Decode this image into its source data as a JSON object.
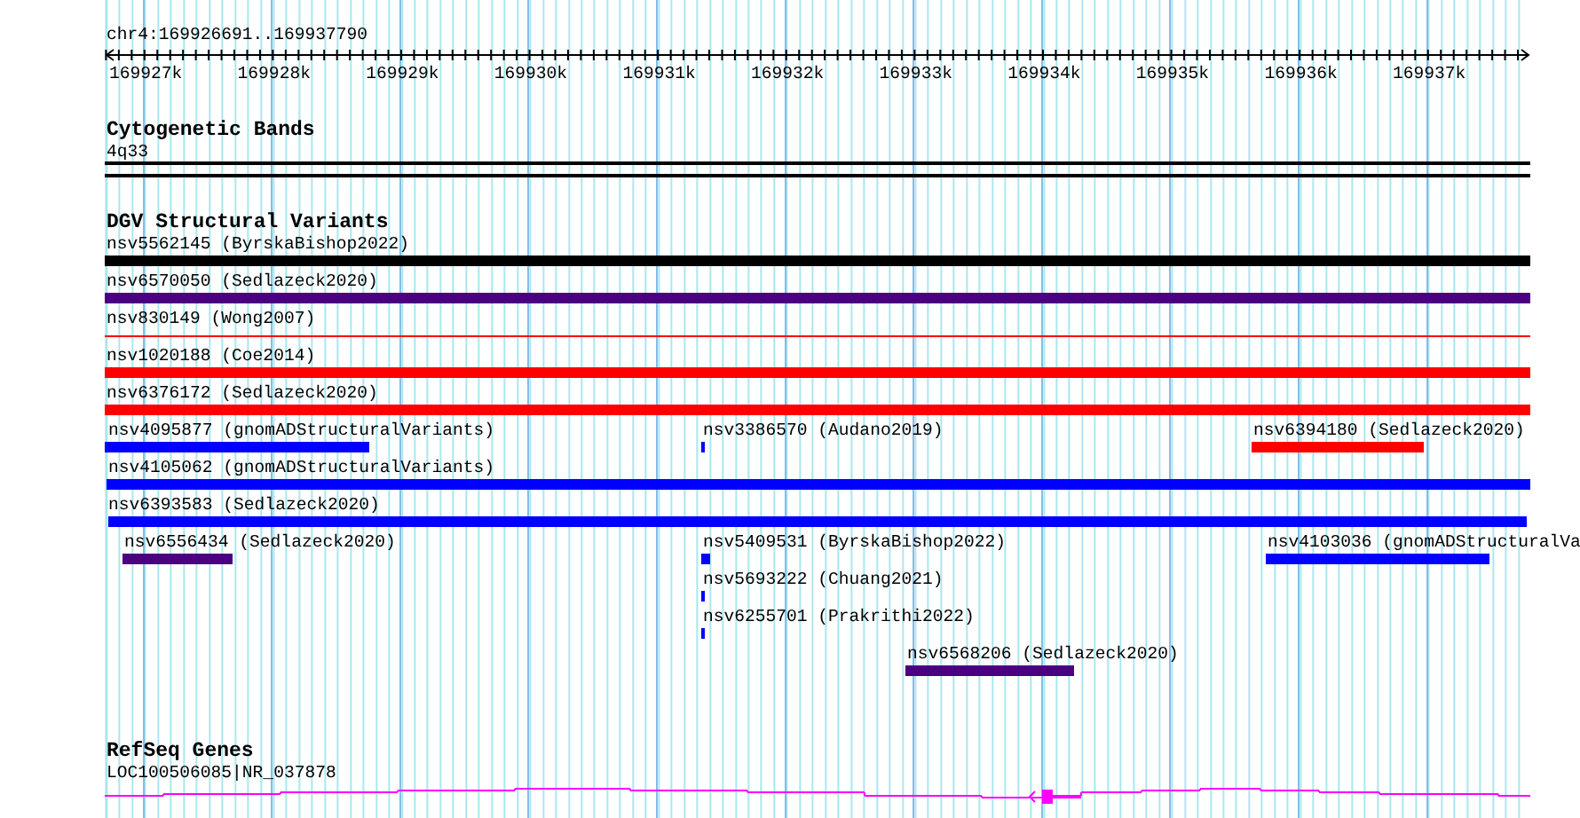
{
  "ruler": {
    "location": "chr4:169926691..169937790",
    "ticks": [
      "169927k",
      "169928k",
      "169929k",
      "169930k",
      "169931k",
      "169932k",
      "169933k",
      "169934k",
      "169935k",
      "169936k",
      "169937k"
    ]
  },
  "tracks": [
    {
      "kind": "bands",
      "title": "Cytogenetic Bands",
      "items": [
        "4q33"
      ]
    },
    {
      "kind": "variants",
      "title": "DGV Structural Variants",
      "rows": [
        {
          "features": [
            {
              "label": "nsv5562145 (ByrskaBishop2022)",
              "color": "#000000",
              "kind": "bar"
            }
          ]
        },
        {
          "features": [
            {
              "label": "nsv6570050 (Sedlazeck2020)",
              "color": "#4b0082",
              "kind": "bar"
            }
          ]
        },
        {
          "features": [
            {
              "label": "nsv830149 (Wong2007)",
              "color": "#ff0000",
              "kind": "line"
            }
          ]
        },
        {
          "features": [
            {
              "label": "nsv1020188 (Coe2014)",
              "color": "#ff0000",
              "kind": "bar"
            }
          ]
        },
        {
          "features": [
            {
              "label": "nsv6376172 (Sedlazeck2020)",
              "color": "#ff0000",
              "kind": "bar"
            }
          ]
        },
        {
          "features": [
            {
              "label": "nsv4095877 (gnomADStructuralVariants)",
              "color": "#0000ff",
              "kind": "bar"
            },
            {
              "label": "nsv3386570 (Audano2019)",
              "color": "#0000ff",
              "kind": "bar"
            },
            {
              "label": "nsv6394180 (Sedlazeck2020)",
              "color": "#ff0000",
              "kind": "bar"
            }
          ]
        },
        {
          "features": [
            {
              "label": "nsv4105062 (gnomADStructuralVariants)",
              "color": "#0000ff",
              "kind": "bar"
            }
          ]
        },
        {
          "features": [
            {
              "label": "nsv6393583 (Sedlazeck2020)",
              "color": "#0000ff",
              "kind": "bar"
            }
          ]
        },
        {
          "features": [
            {
              "label": "nsv6556434 (Sedlazeck2020)",
              "color": "#4b0082",
              "kind": "bar"
            },
            {
              "label": "nsv5409531 (ByrskaBishop2022)",
              "color": "#0000ff",
              "kind": "bar"
            },
            {
              "label": "nsv4103036 (gnomADStructuralVa",
              "color": "#0000ff",
              "kind": "bar"
            }
          ]
        },
        {
          "features": [
            {
              "label": "nsv5693222 (Chuang2021)",
              "color": "#0000ff",
              "kind": "bar"
            }
          ]
        },
        {
          "features": [
            {
              "label": "nsv6255701 (Prakrithi2022)",
              "color": "#0000ff",
              "kind": "bar"
            }
          ]
        },
        {
          "features": [
            {
              "label": "nsv6568206 (Sedlazeck2020)",
              "color": "#4b0082",
              "kind": "bar"
            }
          ]
        }
      ]
    },
    {
      "kind": "genes",
      "title": "RefSeq Genes",
      "genes": [
        {
          "label": "LOC100506085|NR_037878",
          "color": "#ff00ff"
        }
      ]
    }
  ]
}
